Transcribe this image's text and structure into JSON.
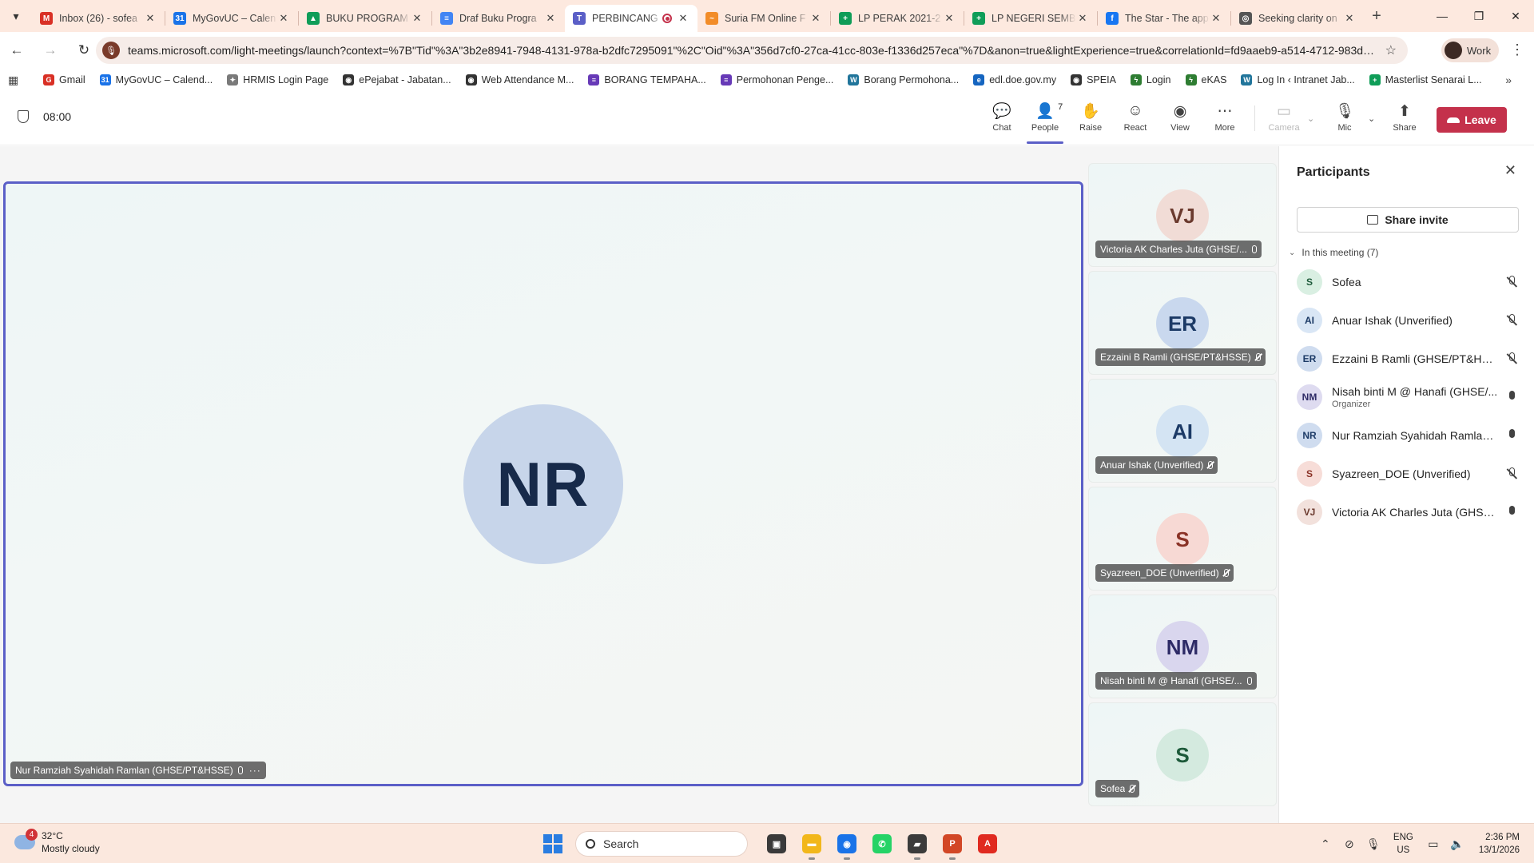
{
  "browser": {
    "tabs": [
      {
        "title": "Inbox (26) - sofea",
        "color": "#d93025",
        "glyph": "M"
      },
      {
        "title": "MyGovUC – Calen",
        "color": "#1a73e8",
        "glyph": "31"
      },
      {
        "title": "BUKU PROGRAM",
        "color": "#0f9d58",
        "glyph": "▲"
      },
      {
        "title": "Draf Buku Progra",
        "color": "#4285f4",
        "glyph": "≡"
      },
      {
        "title": "PERBINCANG",
        "color": "#5b5fc7",
        "glyph": "T",
        "active": true,
        "recording": true
      },
      {
        "title": "Suria FM Online F",
        "color": "#f28c28",
        "glyph": "~"
      },
      {
        "title": "LP PERAK 2021-2",
        "color": "#0f9d58",
        "glyph": "+"
      },
      {
        "title": "LP NEGERI SEMBI",
        "color": "#0f9d58",
        "glyph": "+"
      },
      {
        "title": "The Star - The app",
        "color": "#1877f2",
        "glyph": "f"
      },
      {
        "title": "Seeking clarity on",
        "color": "#555555",
        "glyph": "◎"
      }
    ],
    "url": "teams.microsoft.com/light-meetings/launch?context=%7B\"Tid\"%3A\"3b2e8941-7948-4131-978a-b2dfc7295091\"%2C\"Oid\"%3A\"356d7cf0-27ca-41cc-803e-f1336d257eca\"%7D&anon=true&lightExperience=true&correlationId=fd9aaeb9-a514-4712-983d-87...",
    "profile_label": "Work",
    "bookmarks": [
      {
        "label": "Gmail",
        "color": "#d93025",
        "glyph": "G"
      },
      {
        "label": "MyGovUC – Calend...",
        "color": "#1a73e8",
        "glyph": "31"
      },
      {
        "label": "HRMIS Login Page",
        "color": "#7a7a7a",
        "glyph": "✦"
      },
      {
        "label": "ePejabat - Jabatan...",
        "color": "#333333",
        "glyph": "◉"
      },
      {
        "label": "Web Attendance M...",
        "color": "#333333",
        "glyph": "◉"
      },
      {
        "label": "BORANG TEMPAHA...",
        "color": "#673ab7",
        "glyph": "≡"
      },
      {
        "label": "Permohonan Penge...",
        "color": "#673ab7",
        "glyph": "≡"
      },
      {
        "label": "Borang Permohona...",
        "color": "#21759b",
        "glyph": "W"
      },
      {
        "label": "edl.doe.gov.my",
        "color": "#1565c0",
        "glyph": "e"
      },
      {
        "label": "SPEIA",
        "color": "#333333",
        "glyph": "◉"
      },
      {
        "label": "Login",
        "color": "#2e7d32",
        "glyph": "ϟ"
      },
      {
        "label": "eKAS",
        "color": "#2e7d32",
        "glyph": "ϟ"
      },
      {
        "label": "Log In ‹ Intranet Jab...",
        "color": "#21759b",
        "glyph": "W"
      },
      {
        "label": "Masterlist Senarai L...",
        "color": "#0f9d58",
        "glyph": "+"
      }
    ]
  },
  "meeting": {
    "timer": "08:00",
    "people_count": "7",
    "controls": {
      "chat": "Chat",
      "people": "People",
      "raise": "Raise",
      "react": "React",
      "view": "View",
      "more": "More",
      "camera": "Camera",
      "mic": "Mic",
      "share": "Share",
      "leave": "Leave"
    },
    "main_speaker": {
      "initials": "NR",
      "name": "Nur Ramziah Syahidah Ramlan (GHSE/PT&HSSE)",
      "avatar_color": "#c7d5ea",
      "text_color": "#172a4a"
    },
    "tiles": [
      {
        "initials": "VJ",
        "name": "Victoria AK Charles Juta (GHSE/...",
        "bg": "#f1dcd6",
        "fg": "#6b3a2e",
        "muted": false
      },
      {
        "initials": "ER",
        "name": "Ezzaini B Ramli (GHSE/PT&HSSE)",
        "bg": "#c9d8ee",
        "fg": "#1c3a66",
        "muted": true
      },
      {
        "initials": "AI",
        "name": "Anuar Ishak (Unverified)",
        "bg": "#d4e4f3",
        "fg": "#1c3a66",
        "muted": true
      },
      {
        "initials": "S",
        "name": "Syazreen_DOE (Unverified)",
        "bg": "#f7d9d4",
        "fg": "#8a3226",
        "muted": true
      },
      {
        "initials": "NM",
        "name": "Nisah binti M @ Hanafi (GHSE/...",
        "bg": "#d9d6ee",
        "fg": "#2d2a66",
        "muted": false
      },
      {
        "initials": "S",
        "name": "Sofea",
        "bg": "#d4eadf",
        "fg": "#1d5a3a",
        "muted": true
      }
    ]
  },
  "participants": {
    "title": "Participants",
    "share_invite": "Share invite",
    "section_label": "In this meeting (7)",
    "list": [
      {
        "initials": "S",
        "name": "Sofea",
        "role": "",
        "bg": "#d9efe2",
        "fg": "#1d5a3a",
        "mic": "muted"
      },
      {
        "initials": "AI",
        "name": "Anuar Ishak (Unverified)",
        "role": "",
        "bg": "#d9e6f5",
        "fg": "#1c3a66",
        "mic": "muted"
      },
      {
        "initials": "ER",
        "name": "Ezzaini B Ramli (GHSE/PT&HSSE)",
        "role": "",
        "bg": "#cfdcef",
        "fg": "#1c3a66",
        "mic": "muted"
      },
      {
        "initials": "NM",
        "name": "Nisah binti M @ Hanafi (GHSE/...",
        "role": "Organizer",
        "bg": "#dedbf0",
        "fg": "#2d2a66",
        "mic": "on"
      },
      {
        "initials": "NR",
        "name": "Nur Ramziah Syahidah Ramlan ...",
        "role": "",
        "bg": "#cfdcef",
        "fg": "#1c3a66",
        "mic": "on"
      },
      {
        "initials": "S",
        "name": "Syazreen_DOE (Unverified)",
        "role": "",
        "bg": "#f7ddd8",
        "fg": "#8a3226",
        "mic": "muted"
      },
      {
        "initials": "VJ",
        "name": "Victoria AK Charles Juta (GHSE/...",
        "role": "",
        "bg": "#f2e1dc",
        "fg": "#6b3a2e",
        "mic": "on"
      }
    ]
  },
  "taskbar": {
    "weather_temp": "32°C",
    "weather_desc": "Mostly cloudy",
    "weather_badge": "4",
    "search_placeholder": "Search",
    "apps": [
      {
        "name": "task-view",
        "color": "#3a3a3a",
        "glyph": "▣"
      },
      {
        "name": "file-explorer",
        "color": "#f2b71b",
        "glyph": "▬"
      },
      {
        "name": "chrome",
        "color": "#1a73e8",
        "glyph": "◉"
      },
      {
        "name": "whatsapp",
        "color": "#25d366",
        "glyph": "✆"
      },
      {
        "name": "sticky-notes",
        "color": "#3b3b3b",
        "glyph": "▰"
      },
      {
        "name": "powerpoint",
        "color": "#d24726",
        "glyph": "P"
      },
      {
        "name": "acrobat",
        "color": "#e02a20",
        "glyph": "A"
      }
    ],
    "lang_1": "ENG",
    "lang_2": "US",
    "time": "2:36 PM",
    "date": "13/1/2026"
  }
}
